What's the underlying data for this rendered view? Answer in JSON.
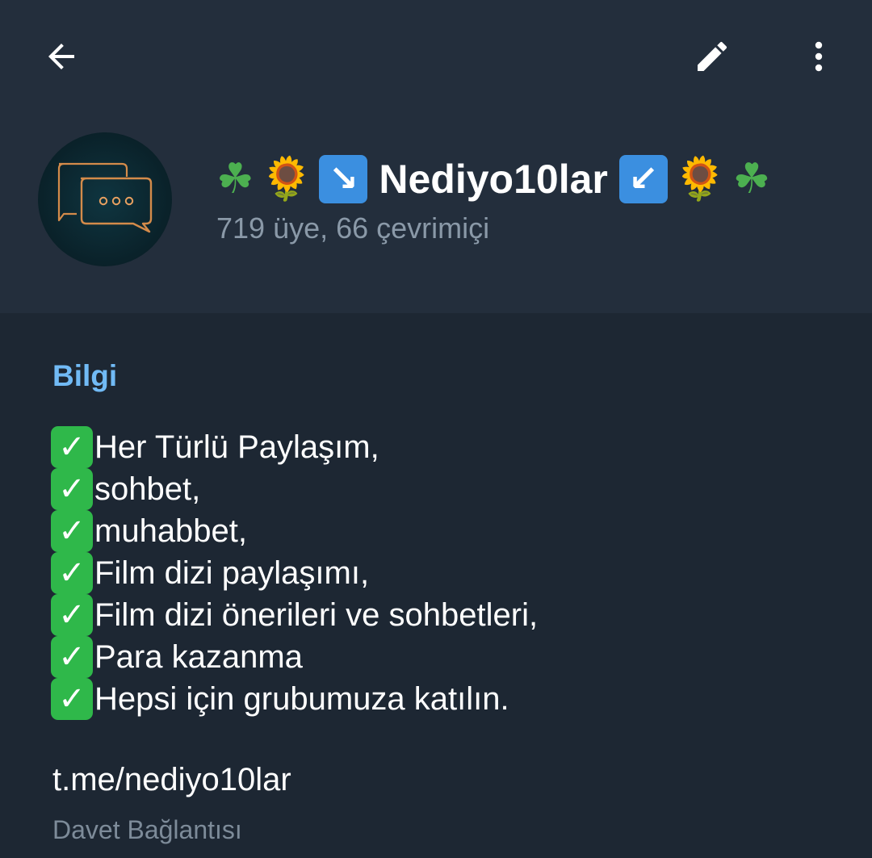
{
  "toolbar": {
    "back_icon": "arrow-left-icon",
    "edit_icon": "pencil-icon",
    "more_icon": "more-vertical-icon"
  },
  "profile": {
    "avatar_icon": "chat-bubbles-icon",
    "title_prefix_emojis": [
      "☘",
      "🌻",
      "↘"
    ],
    "name": "Nediyo10lar",
    "title_suffix_emojis": [
      "↙",
      "🌻",
      "☘"
    ],
    "subtitle": "719 üye, 66 çevrimiçi"
  },
  "info": {
    "section_title": "Bilgi",
    "check_icon": "✓",
    "lines": [
      "Her Türlü Paylaşım,",
      "sohbet,",
      "muhabbet,",
      "Film dizi paylaşımı,",
      "Film dizi önerileri ve sohbetleri,",
      "Para kazanma",
      "Hepsi için grubumuza katılın."
    ],
    "link": "t.me/nediyo10lar",
    "link_caption": "Davet Bağlantısı"
  },
  "colors": {
    "background": "#1d2733",
    "header": "#232e3c",
    "accent": "#71baf5",
    "subtitle": "#8a99a8",
    "check": "#2fb84a"
  }
}
